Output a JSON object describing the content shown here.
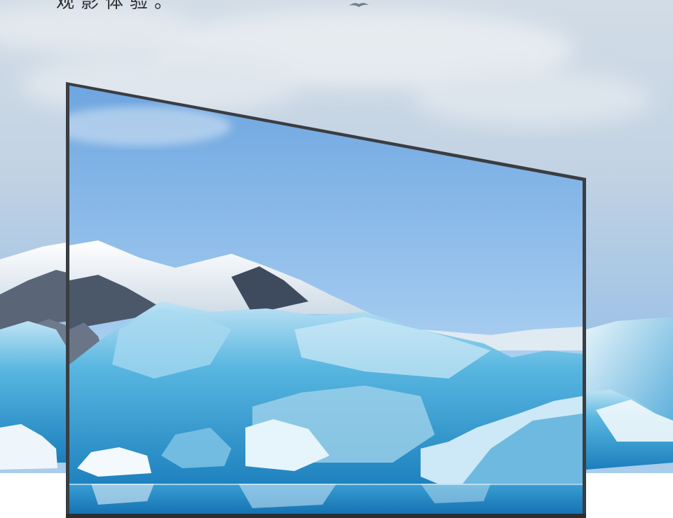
{
  "headline": {
    "text": "观影体验。"
  },
  "colors": {
    "sky_top": "#c9d6e3",
    "sky_bottom": "#9fc3e6",
    "screen_sky": "#86b6e8",
    "ice": "#3aa0d4",
    "bezel": "#3a3d42"
  },
  "icons": {
    "bird": "seagull-icon"
  }
}
